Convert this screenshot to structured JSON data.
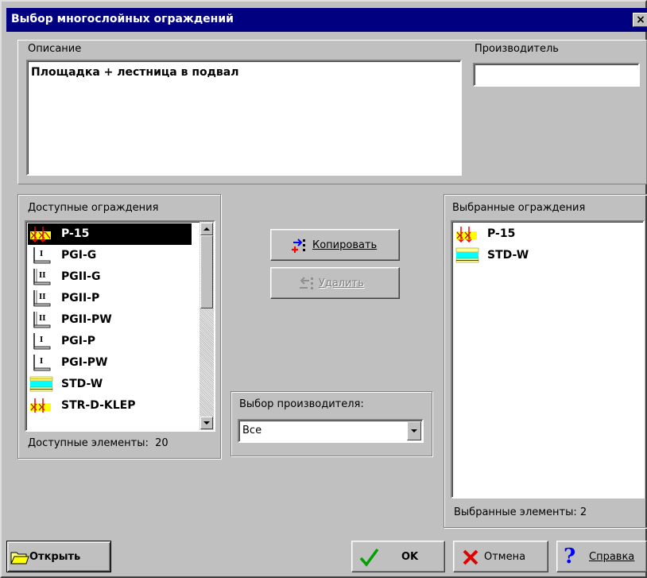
{
  "window": {
    "title": "Выбор многослойных ограждений",
    "close_label": "×"
  },
  "description": {
    "label": "Описание",
    "value": "Площадка + лестница в подвал"
  },
  "manufacturer": {
    "label": "Производитель",
    "value": ""
  },
  "available": {
    "label": "Доступные ограждения",
    "items": [
      "P-15",
      "PGI-G",
      "PGII-G",
      "PGII-P",
      "PGII-PW",
      "PGI-P",
      "PGI-PW",
      "STD-W",
      "STR-D-KLEP"
    ],
    "count_label": "Доступные элементы:",
    "count": "20"
  },
  "selected": {
    "label": "Выбранные ограждения",
    "items": [
      "P-15",
      "STD-W"
    ],
    "count_label": "Выбранные элементы:",
    "count": "2"
  },
  "actions": {
    "copy_label": "Копировать",
    "delete_label": "Удалить"
  },
  "manufacturer_select": {
    "label": "Выбор производителя:",
    "value": "Все"
  },
  "buttons": {
    "open": "Открыть",
    "ok": "OK",
    "cancel": "Отмена",
    "help": "Справка"
  }
}
